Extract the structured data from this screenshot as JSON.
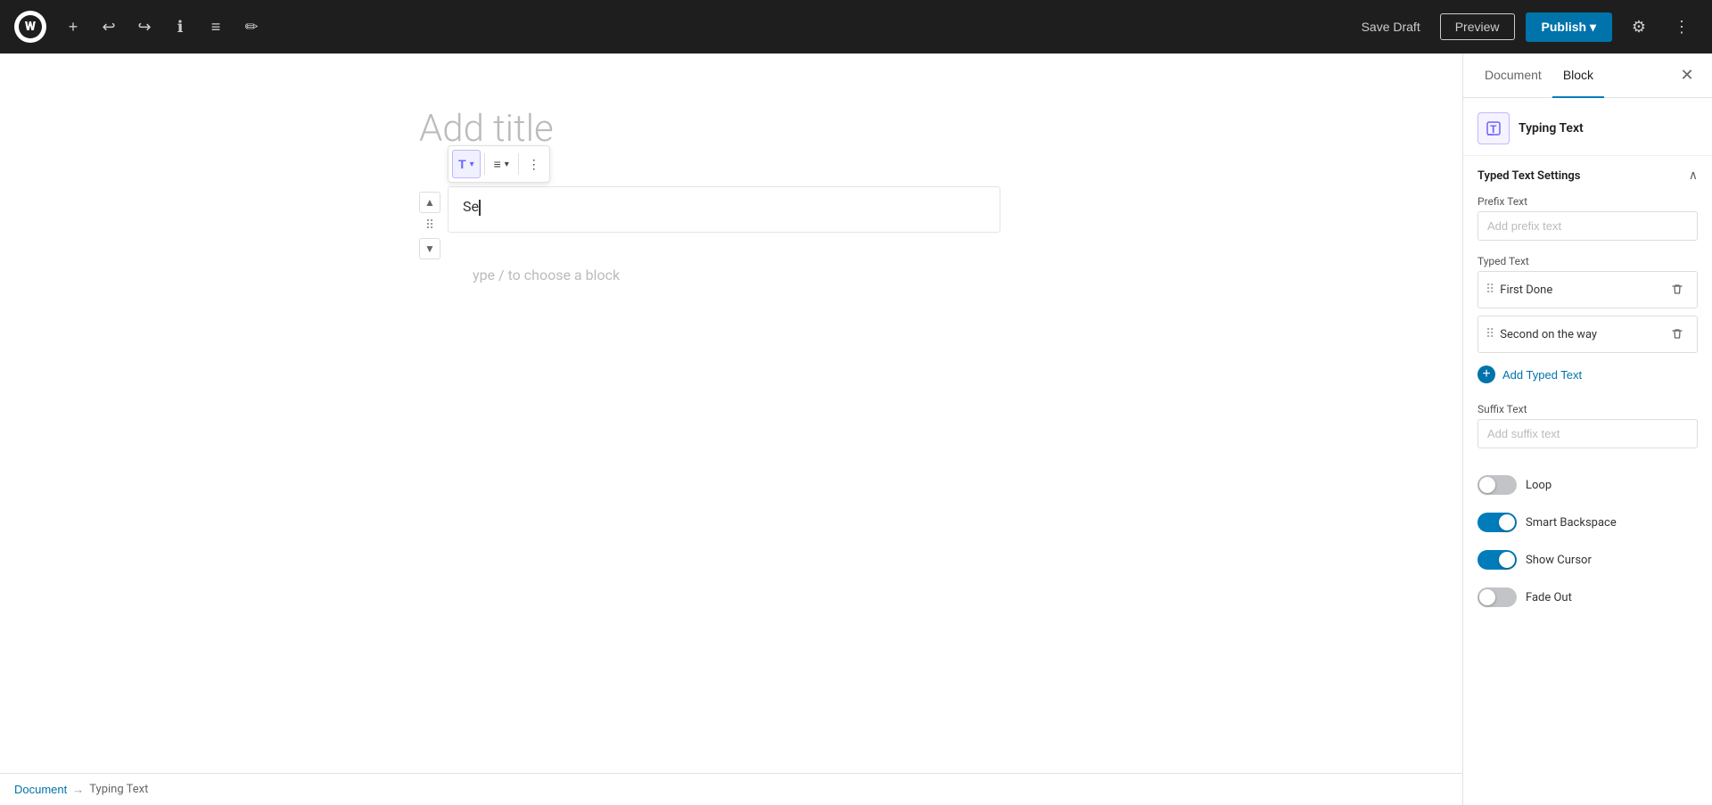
{
  "toolbar": {
    "save_draft_label": "Save Draft",
    "preview_label": "Preview",
    "publish_label": "Publish ▾",
    "settings_icon": "⚙",
    "more_icon": "⋮",
    "add_icon": "+",
    "undo_icon": "↩",
    "redo_icon": "↪",
    "info_icon": "ℹ",
    "list_icon": "≡",
    "pencil_icon": "✏"
  },
  "editor": {
    "title_placeholder": "Add title",
    "block_ghost_text": "ype / to choose a block",
    "block_current_text": "Se",
    "block_toolbar": {
      "type_icon": "T",
      "type_arrow": "▾",
      "align_icon": "≡",
      "align_arrow": "▾",
      "more_icon": "⋮"
    }
  },
  "right_panel": {
    "tab_document": "Document",
    "tab_block": "Block",
    "close_icon": "✕",
    "block_name": "Typing Text",
    "block_icon_label": "T̲",
    "sections": {
      "typed_text_settings": {
        "title": "Typed Text Settings",
        "toggle_icon": "∧",
        "prefix_text": {
          "label": "Prefix Text",
          "placeholder": "Add prefix text"
        },
        "typed_text": {
          "label": "Typed Text",
          "items": [
            {
              "value": "First Done"
            },
            {
              "value": "Second on the way"
            }
          ],
          "delete_icon": "🗑",
          "drag_icon": "⠿"
        },
        "add_typed_text_label": "Add Typed Text",
        "suffix_text": {
          "label": "Suffix Text",
          "placeholder": "Add suffix text"
        },
        "toggles": [
          {
            "id": "loop",
            "label": "Loop",
            "state": "off"
          },
          {
            "id": "smart_backspace",
            "label": "Smart Backspace",
            "state": "on"
          },
          {
            "id": "show_cursor",
            "label": "Show Cursor",
            "state": "on"
          },
          {
            "id": "fade_out",
            "label": "Fade Out",
            "state": "off"
          }
        ]
      }
    }
  },
  "breadcrumb": {
    "document_label": "Document",
    "separator": "→",
    "current_label": "Typing Text"
  }
}
